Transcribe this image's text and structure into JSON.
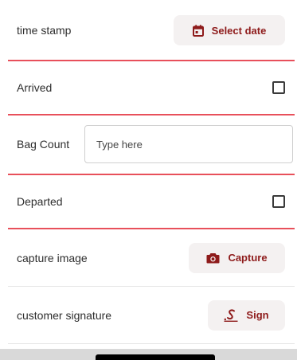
{
  "timestamp_row": {
    "label": "time stamp",
    "button_label": "Select date",
    "icon": "calendar-icon"
  },
  "arrived_row": {
    "label": "Arrived",
    "checked": false
  },
  "bag_count_row": {
    "label": "Bag Count",
    "value": "",
    "placeholder": "Type here"
  },
  "departed_row": {
    "label": "Departed",
    "checked": false
  },
  "capture_image_row": {
    "label": "capture image",
    "button_label": "Capture",
    "icon": "camera-icon"
  },
  "signature_row": {
    "label": "customer signature",
    "button_label": "Sign",
    "icon": "signature-icon"
  },
  "colors": {
    "accent": "#8e1b1b",
    "separator": "#e8505b",
    "button_bg": "#f4f1f1"
  }
}
